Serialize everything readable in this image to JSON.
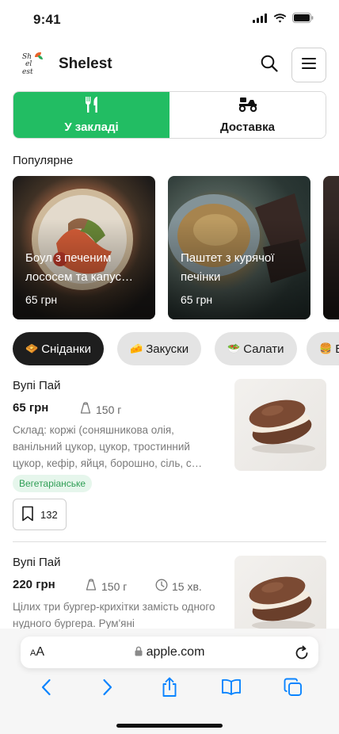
{
  "status": {
    "time": "9:41"
  },
  "header": {
    "title": "Shelest",
    "logo_lines": [
      "Sh",
      "el",
      "est"
    ]
  },
  "service_mode": {
    "tabs": [
      {
        "label": "У закладі",
        "icon": "cutlery-icon",
        "active": true
      },
      {
        "label": "Доставка",
        "icon": "scooter-icon",
        "active": false
      }
    ]
  },
  "popular": {
    "title": "Популярне",
    "items": [
      {
        "name": "Боул з печеним лососем та капус…",
        "price": "65 грн"
      },
      {
        "name": "Паштет з курячої печінки",
        "price": "65 грн"
      },
      {
        "name": "",
        "price": ""
      }
    ]
  },
  "categories": [
    {
      "label": "Сніданки",
      "emoji": "🧇",
      "active": true
    },
    {
      "label": "Закуски",
      "emoji": "🧀",
      "active": false
    },
    {
      "label": "Салати",
      "emoji": "🥗",
      "active": false
    },
    {
      "label": "Б",
      "emoji": "🍔",
      "active": false
    }
  ],
  "menu": [
    {
      "name": "Вупі Пай",
      "price": "65 грн",
      "weight": "150 г",
      "description": "Склад: коржі (соняшникова олія, ванільний цукор, цукор, тростинний цукор, кефір, яйця, борошно, сіль, с…",
      "badge": "Вегетаріанське",
      "saves": "132"
    },
    {
      "name": "Вупі Пай",
      "price": "220 грн",
      "weight": "150 г",
      "time": "15 хв.",
      "description": "Цілих три бургер-крихітки замість одного нудного бургера. Рум'яні"
    }
  ],
  "browser": {
    "url": "apple.com",
    "aa_label": "AA"
  },
  "colors": {
    "accent_green": "#22bd63",
    "chip_active": "#1e1e1e",
    "veg_text": "#2f9e55",
    "ios_blue": "#0a84ff"
  }
}
